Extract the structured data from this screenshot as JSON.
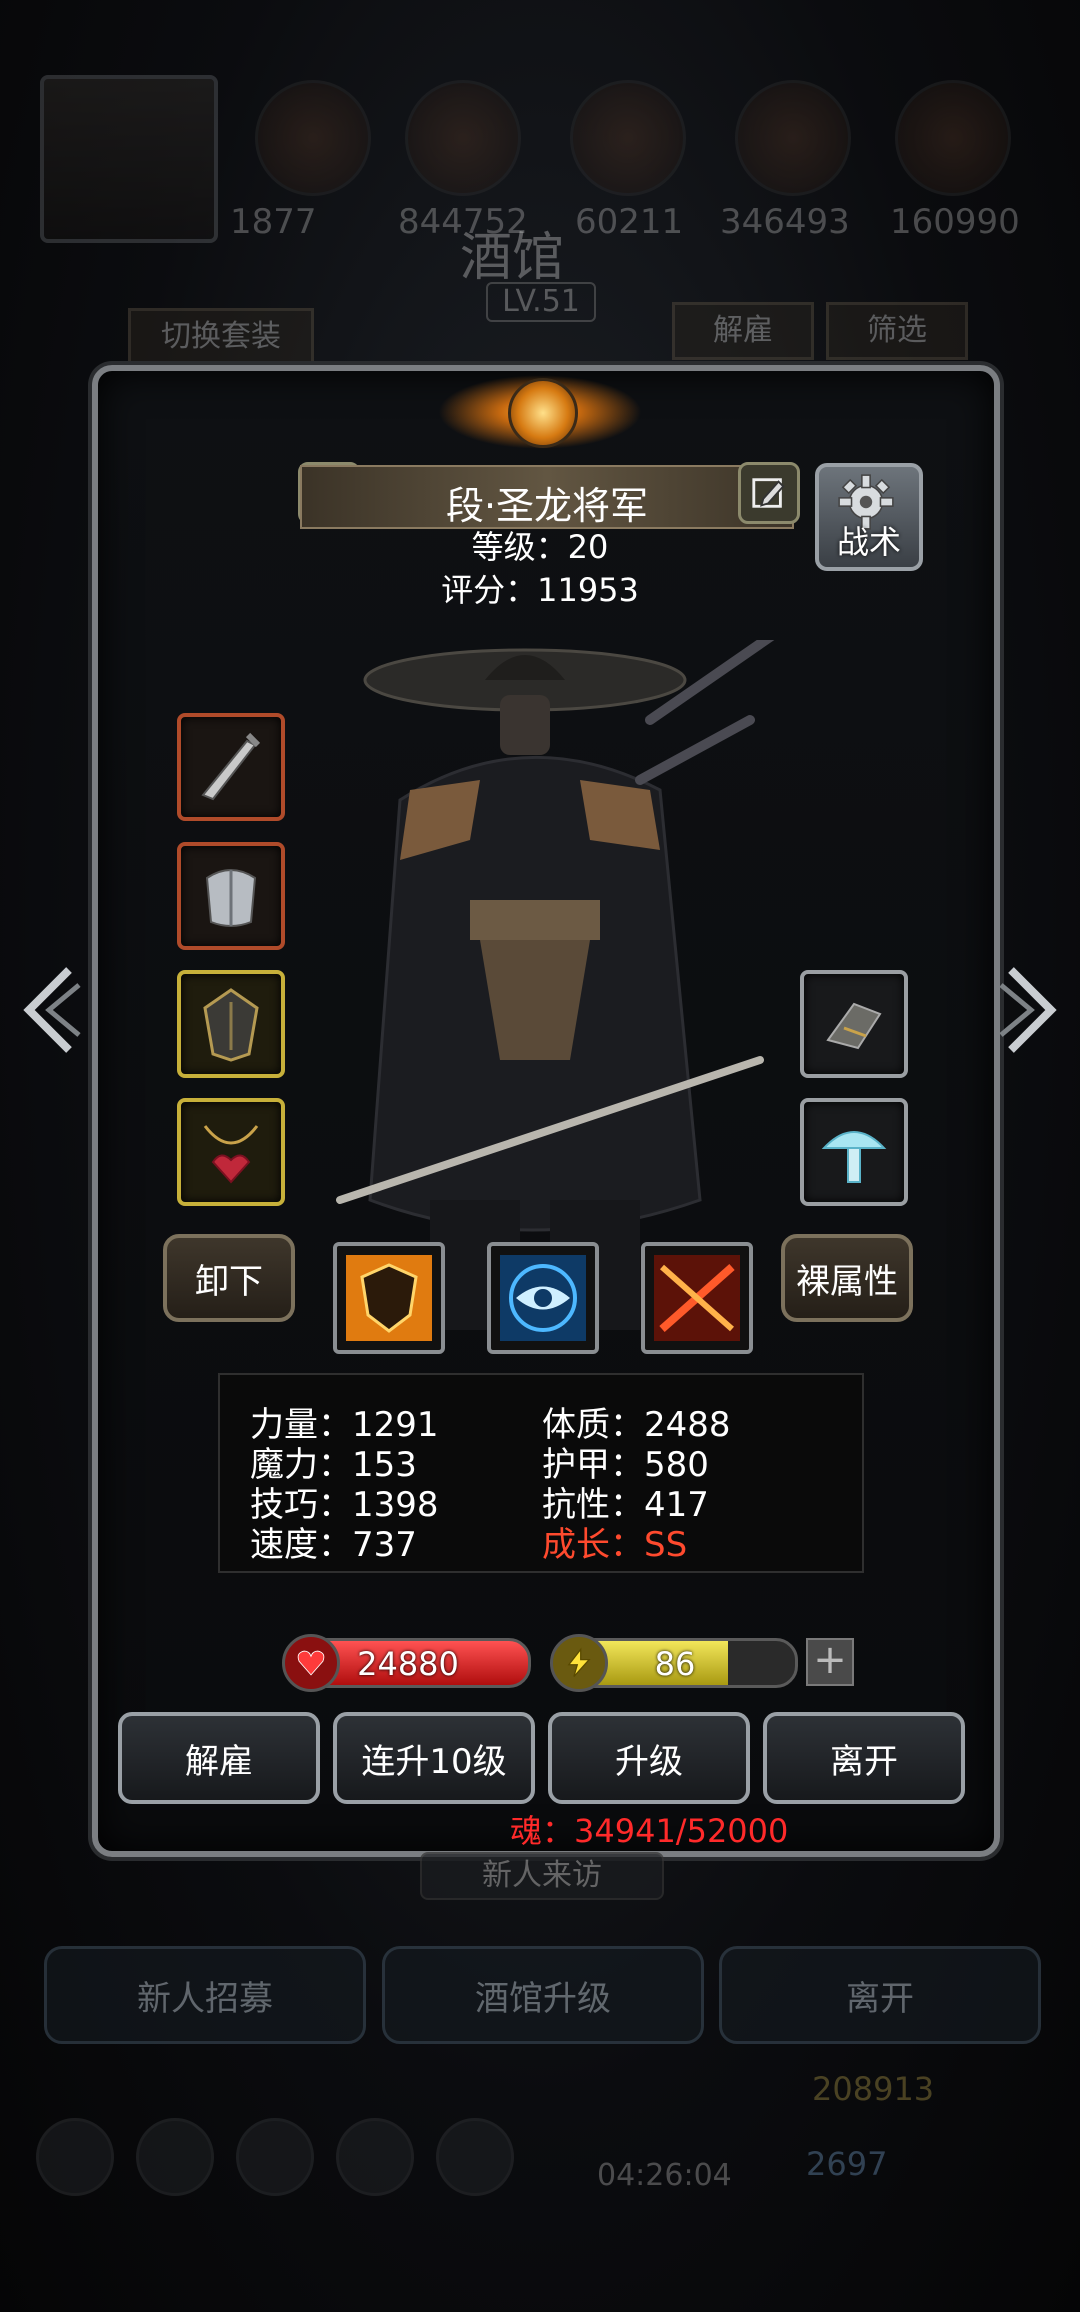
{
  "background": {
    "top_resources": [
      "1877",
      "844752",
      "60211",
      "346493",
      "160990"
    ],
    "tavern_title": "酒馆",
    "tavern_level": "LV.51",
    "switch_outfit_label": "切换套装",
    "dismiss_label": "解雇",
    "filter_label": "筛选",
    "newcomer_label": "新人来访",
    "bottom_buttons": [
      "新人招募",
      "酒馆升级",
      "离开"
    ],
    "timer": "04:26:04",
    "gold": "208913",
    "gems": "2697"
  },
  "hero": {
    "name": "段·圣龙将军",
    "level_text": "等级：20",
    "score_text": "评分：11953",
    "tactics_label": "战术"
  },
  "buttons": {
    "unequip": "卸下",
    "bare_attributes": "裸属性"
  },
  "equipment_left": [
    {
      "name": "sword-icon",
      "rarity": "red"
    },
    {
      "name": "armor-icon",
      "rarity": "red"
    },
    {
      "name": "shoulder-icon",
      "rarity": "gold"
    },
    {
      "name": "necklace-icon",
      "rarity": "gold"
    }
  ],
  "equipment_right": [
    {
      "name": "gauntlet-icon",
      "rarity": "gray"
    },
    {
      "name": "frost-mushroom-icon",
      "rarity": "gray"
    }
  ],
  "skills": [
    "fire-shield-icon",
    "eye-icon",
    "slash-icon"
  ],
  "stats": {
    "strength": "力量：1291",
    "magic": "魔力：153",
    "skill": "技巧：1398",
    "speed": "速度：737",
    "constitution": "体质：2488",
    "armor": "护甲：580",
    "resistance": "抗性：417",
    "growth": "成长：SS"
  },
  "bars": {
    "hp": "24880",
    "energy": "86",
    "energy_fraction": 0.72
  },
  "actions": [
    "解雇",
    "连升10级",
    "升级",
    "离开"
  ],
  "soul": "魂：34941/52000",
  "colors": {
    "growth": "#ff4a2e",
    "soul": "#ff2a2a",
    "hp": "#d81e1e",
    "energy": "#e2d43a"
  }
}
